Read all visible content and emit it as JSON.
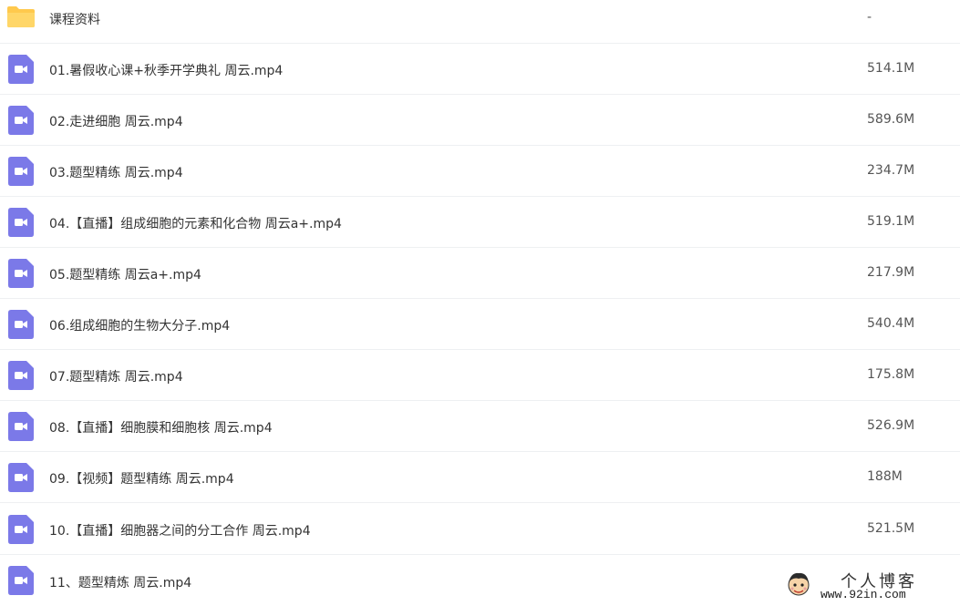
{
  "folder": {
    "name": "课程资料",
    "size": "-"
  },
  "files": [
    {
      "name": "01.暑假收心课+秋季开学典礼 周云.mp4",
      "size": "514.1M"
    },
    {
      "name": "02.走进细胞 周云.mp4",
      "size": "589.6M"
    },
    {
      "name": "03.题型精练 周云.mp4",
      "size": "234.7M"
    },
    {
      "name": "04.【直播】组成细胞的元素和化合物 周云a+.mp4",
      "size": "519.1M"
    },
    {
      "name": "05.题型精练 周云a+.mp4",
      "size": "217.9M"
    },
    {
      "name": "06.组成细胞的生物大分子.mp4",
      "size": "540.4M"
    },
    {
      "name": "07.题型精炼 周云.mp4",
      "size": "175.8M"
    },
    {
      "name": "08.【直播】细胞膜和细胞核 周云.mp4",
      "size": "526.9M"
    },
    {
      "name": "09.【视频】题型精练 周云.mp4",
      "size": "188M"
    },
    {
      "name": "10.【直播】细胞器之间的分工合作 周云.mp4",
      "size": "521.5M"
    },
    {
      "name": "11、题型精炼 周云.mp4",
      "size": ""
    }
  ],
  "icons": {
    "folder": "folder-icon",
    "video": "video-file-icon"
  },
  "colors": {
    "folder": "#ffc94d",
    "video": "#7b79e8"
  },
  "watermark": {
    "title": "个人博客",
    "url": "www.92in.com"
  }
}
